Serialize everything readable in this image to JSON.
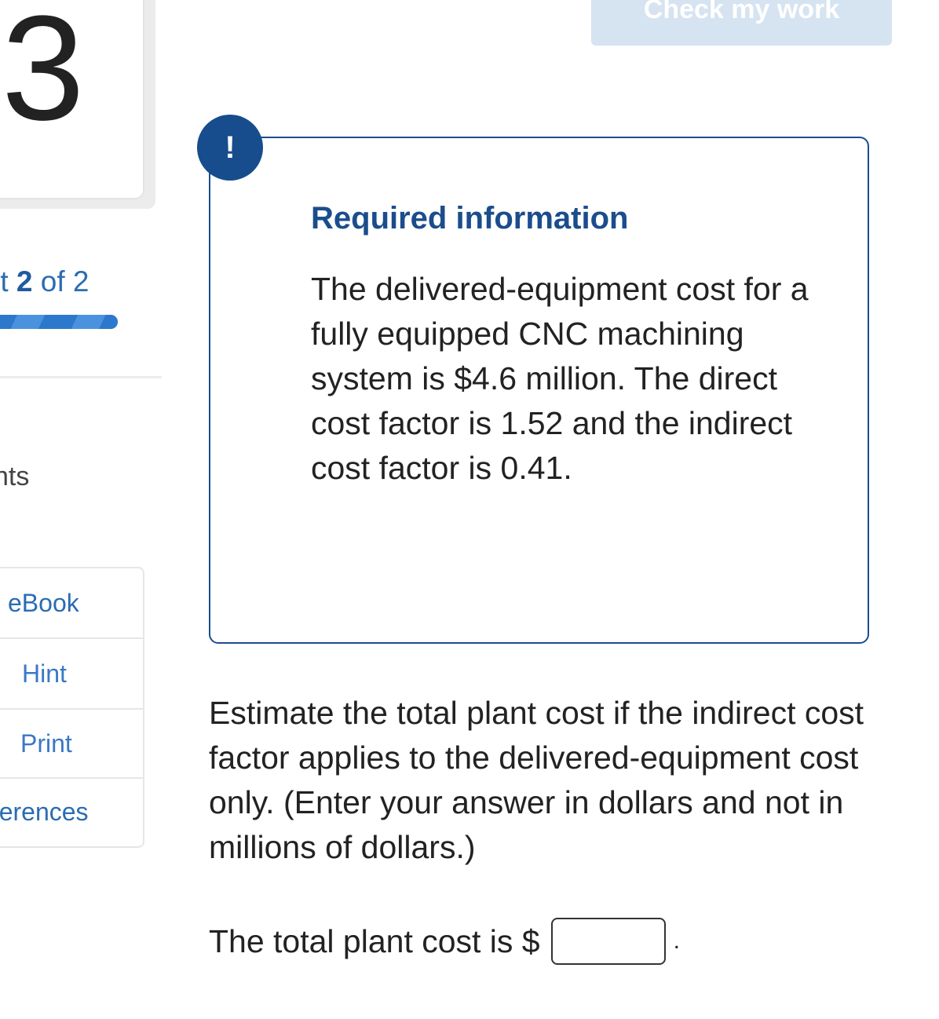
{
  "left_panel": {
    "question_number": "3",
    "part_prefix": "rt ",
    "part_current": "2",
    "part_suffix": " of 2",
    "progress_fraction": 1.0,
    "points_label": "nts",
    "tools": [
      {
        "label": "eBook"
      },
      {
        "label": "Hint"
      },
      {
        "label": "Print"
      },
      {
        "label": "eferences"
      }
    ]
  },
  "header": {
    "check_button_label": "Check my work"
  },
  "required_info": {
    "badge": "!",
    "title": "Required information",
    "text": "The delivered-equipment cost for a fully equipped CNC machining system is $4.6 million. The direct cost factor is 1.52 and the indirect cost factor is 0.41."
  },
  "question": {
    "prompt": "Estimate the total plant cost if the indirect cost factor applies to the delivered-equipment cost only. (Enter your answer in dollars and not in millions of dollars.)",
    "answer_label": "The total plant cost is $",
    "answer_value": "",
    "answer_suffix": "."
  },
  "colors": {
    "primary": "#1b4d8c",
    "link": "#2a6cb3",
    "button_disabled_bg": "#d6e3f1"
  }
}
